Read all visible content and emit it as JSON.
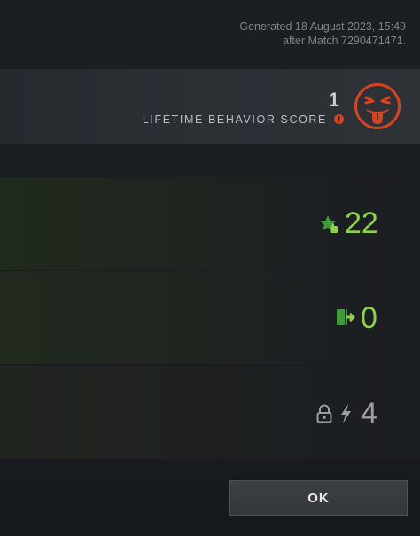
{
  "header": {
    "generated_line": "Generated 18 August 2023, 15:49",
    "match_line": "after Match 7290471471."
  },
  "behavior": {
    "score": "1",
    "label": "LIFETIME BEHAVIOR SCORE",
    "info_icon": "info-icon",
    "face_icon": "angry-tongue-face-icon",
    "face_color": "#d8431f"
  },
  "stats": [
    {
      "icon": "star-thumbs-up-icon",
      "value": "22",
      "color": "#8fd14a"
    },
    {
      "icon": "abandon-exit-door-icon",
      "value": "0",
      "color": "#8fd14a"
    },
    {
      "icon": "lock-lightning-icon",
      "value": "4",
      "color": "#9a9fa4"
    }
  ],
  "footer": {
    "ok_label": "OK"
  }
}
